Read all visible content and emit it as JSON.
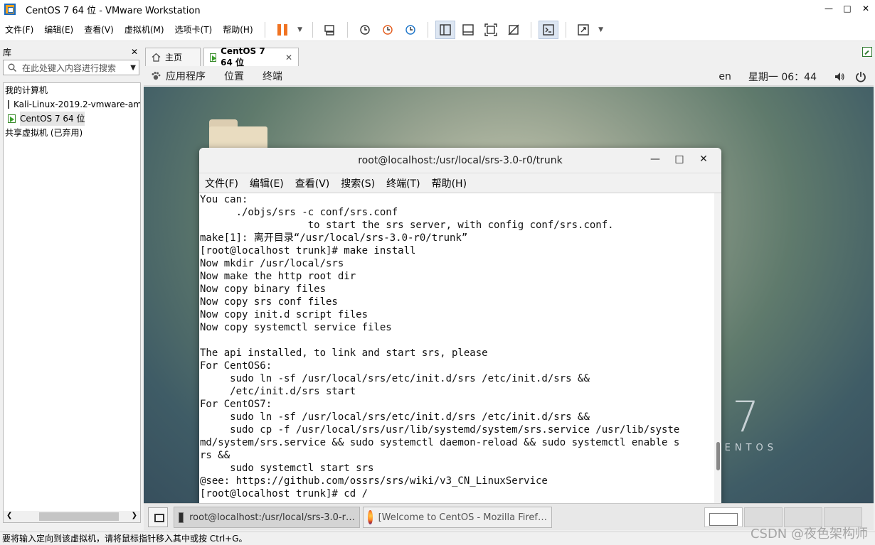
{
  "window": {
    "title": "CentOS 7 64 位 - VMware Workstation",
    "min": "—",
    "max": "□",
    "close": "✕"
  },
  "menu": [
    "文件(F)",
    "编辑(E)",
    "查看(V)",
    "虚拟机(M)",
    "选项卡(T)",
    "帮助(H)"
  ],
  "library": {
    "title": "库",
    "close": "✕",
    "search_placeholder": "在此处键入内容进行搜索",
    "items": [
      {
        "label": "我的计算机"
      },
      {
        "label": "Kali-Linux-2019.2-vmware-am"
      },
      {
        "label": "CentOS 7 64 位"
      },
      {
        "label": "共享虚拟机 (已弃用)"
      }
    ]
  },
  "tabs": {
    "home": "主页",
    "vm": "CentOS 7 64 位"
  },
  "gnome": {
    "apps": "应用程序",
    "places": "位置",
    "terminal": "终端",
    "lang": "en",
    "clock": "星期一 06：44"
  },
  "terminal": {
    "title": "root@localhost:/usr/local/srs-3.0-r0/trunk",
    "menu": [
      "文件(F)",
      "编辑(E)",
      "查看(V)",
      "搜索(S)",
      "终端(T)",
      "帮助(H)"
    ],
    "lines": [
      "You can:",
      "      ./objs/srs -c conf/srs.conf",
      "                  to start the srs server, with config conf/srs.conf.",
      "make[1]: 离开目录“/usr/local/srs-3.0-r0/trunk”",
      "[root@localhost trunk]# make install",
      "Now mkdir /usr/local/srs",
      "Now make the http root dir",
      "Now copy binary files",
      "Now copy srs conf files",
      "Now copy init.d script files",
      "Now copy systemctl service files",
      "",
      "The api installed, to link and start srs, please",
      "For CentOS6:",
      "     sudo ln -sf /usr/local/srs/etc/init.d/srs /etc/init.d/srs &&",
      "     /etc/init.d/srs start",
      "For CentOS7:",
      "     sudo ln -sf /usr/local/srs/etc/init.d/srs /etc/init.d/srs &&",
      "     sudo cp -f /usr/local/srs/usr/lib/systemd/system/srs.service /usr/lib/syste",
      "md/system/srs.service && sudo systemctl daemon-reload && sudo systemctl enable s",
      "rs &&",
      "     sudo systemctl start srs",
      "@see: https://github.com/ossrs/srs/wiki/v3_CN_LinuxService",
      "[root@localhost trunk]# cd /"
    ]
  },
  "desktop": {
    "brand_number": "7",
    "brand_name": "CENTOS"
  },
  "taskbar": {
    "task1": "root@localhost:/usr/local/srs-3.0-r…",
    "task2": "[Welcome to CentOS - Mozilla Firef…"
  },
  "status": "要将输入定向到该虚拟机，请将鼠标指针移入其中或按 Ctrl+G。",
  "watermark": "CSDN @夜色架构师"
}
